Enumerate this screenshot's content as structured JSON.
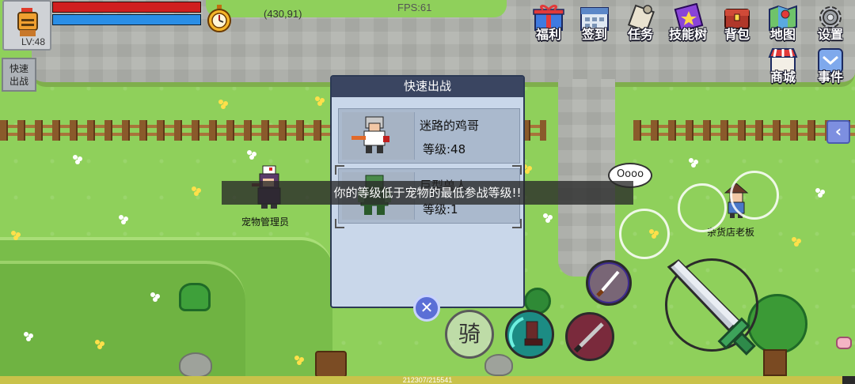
{
  "hud": {
    "level": "LV:48",
    "hp_fraction": 1.0,
    "mp_fraction": 1.0,
    "coords": "(430,91)",
    "fps": "FPS:61",
    "quick_battle_label": "快速\n出战"
  },
  "menu": {
    "row1": [
      {
        "label": "福利",
        "icon": "gift-icon"
      },
      {
        "label": "签到",
        "icon": "calendar-icon"
      },
      {
        "label": "任务",
        "icon": "scroll-icon"
      },
      {
        "label": "技能树",
        "icon": "skill-book-icon"
      },
      {
        "label": "背包",
        "icon": "chest-icon"
      },
      {
        "label": "地图",
        "icon": "map-icon"
      },
      {
        "label": "设置",
        "icon": "gear-icon"
      }
    ],
    "row2": [
      {
        "label": "商城",
        "icon": "shop-icon"
      },
      {
        "label": "事件",
        "icon": "event-icon"
      }
    ]
  },
  "npcs": {
    "pet_manager": "宠物管理员",
    "shopkeeper": "杂货店老板",
    "speech": "Oooo"
  },
  "dialog": {
    "title": "快速出战",
    "pets": [
      {
        "name": "迷路的鸡哥",
        "level": "等级:48"
      },
      {
        "name": "巨型兽人",
        "level": "等级:1"
      }
    ]
  },
  "toast": "你的等级低于宠物的最低参战等级!!",
  "skills": {
    "ride_label": "骑"
  },
  "exp": {
    "text": "212307/215541",
    "fraction": 0.985
  },
  "colors": {
    "hp": "#d01f1f",
    "mp": "#2a8ee6",
    "dialog_header": "#3a4561",
    "grass": "#8fd05b"
  }
}
